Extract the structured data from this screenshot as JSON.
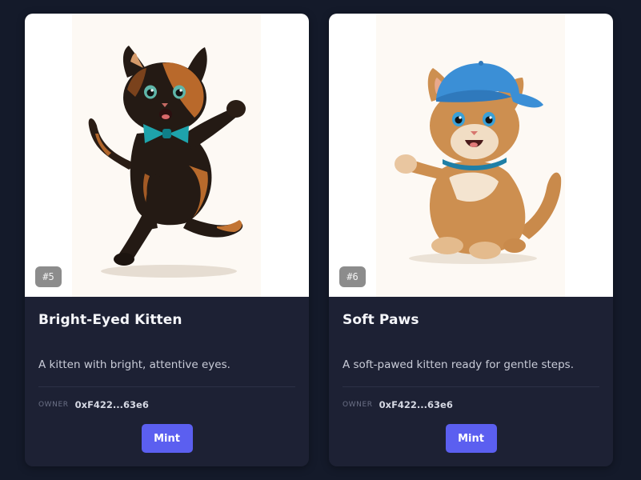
{
  "cards": [
    {
      "badge": "#5",
      "title": "Bright-Eyed Kitten",
      "description": "A kitten with bright, attentive eyes.",
      "owner_label": "OWNER",
      "owner_value": "0xF422...63e6",
      "mint_label": "Mint",
      "image_subject": "dancing-tortoiseshell-kitten-with-teal-bowtie"
    },
    {
      "badge": "#6",
      "title": "Soft Paws",
      "description": "A soft-pawed kitten ready for gentle steps.",
      "owner_label": "OWNER",
      "owner_value": "0xF422...63e6",
      "mint_label": "Mint",
      "image_subject": "orange-kitten-with-blue-cap-waving"
    }
  ],
  "colors": {
    "page_background": "#141a2a",
    "card_background": "#1d2134",
    "accent": "#5b5ff0",
    "badge": "#8c8c8c"
  }
}
